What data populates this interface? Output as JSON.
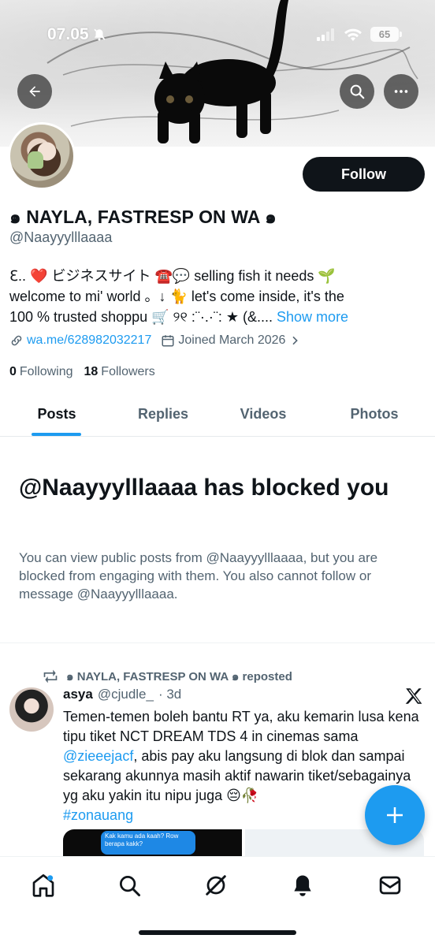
{
  "status_bar": {
    "time": "07.05",
    "battery": "65"
  },
  "header": {
    "follow_label": "Follow"
  },
  "profile": {
    "name": "๑ NAYLA, FASTRESP ON WA ๑",
    "handle": "@Naayyylllaaaa",
    "bio_line1": "ℇ.. ❤️ ビジネスサイト ☎️💬 selling fish it needs 🌱",
    "bio_line2": "welcome to mi' world 。↓ 🐈 let's come inside, it's the",
    "bio_line3": "100 % trusted shoppu 🛒 ୨୧ :¨·.·¨: ★ (&....",
    "show_more": "Show more",
    "link": "wa.me/628982032217",
    "joined": "Joined March 2026",
    "following_count": "0",
    "following_label": "Following",
    "followers_count": "18",
    "followers_label": "Followers"
  },
  "tabs": [
    "Posts",
    "Replies",
    "Videos",
    "Photos"
  ],
  "blocked": {
    "title": "@Naayyylllaaaa has blocked you",
    "description": "You can view public posts from @Naayyylllaaaa, but you are blocked from engaging with them. You also cannot follow or message @Naayyylllaaaa."
  },
  "post": {
    "repost_label": "๑ NAYLA, FASTRESP ON WA ๑ reposted",
    "author_name": "asya",
    "author_handle": "@cjudle_",
    "age": "· 3d",
    "text_part1": "Temen-temen boleh bantu RT ya, aku kemarin lusa kena tipu tiket NCT DREAM TDS 4 in cinemas sama ",
    "mention": "@zieeejacf",
    "text_part2": ", abis pay aku langsung di blok dan sampai sekarang akunnya masih aktif nawarin tiket/sebagainya yg aku yakin itu nipu juga 😔🥀",
    "hashtag": "#zonauang",
    "media_text": "Kak kamu ada kaah? Row berapa kakk?"
  },
  "colors": {
    "accent": "#1d9bf0",
    "text": "#0f1419",
    "muted": "#536471"
  },
  "icons": [
    "back-arrow-icon",
    "search-icon",
    "more-icon",
    "link-icon",
    "calendar-icon",
    "chevron-right-icon",
    "repost-icon",
    "x-logo-icon",
    "plus-icon",
    "home-icon",
    "explore-icon",
    "grok-icon",
    "notifications-icon",
    "messages-icon"
  ]
}
